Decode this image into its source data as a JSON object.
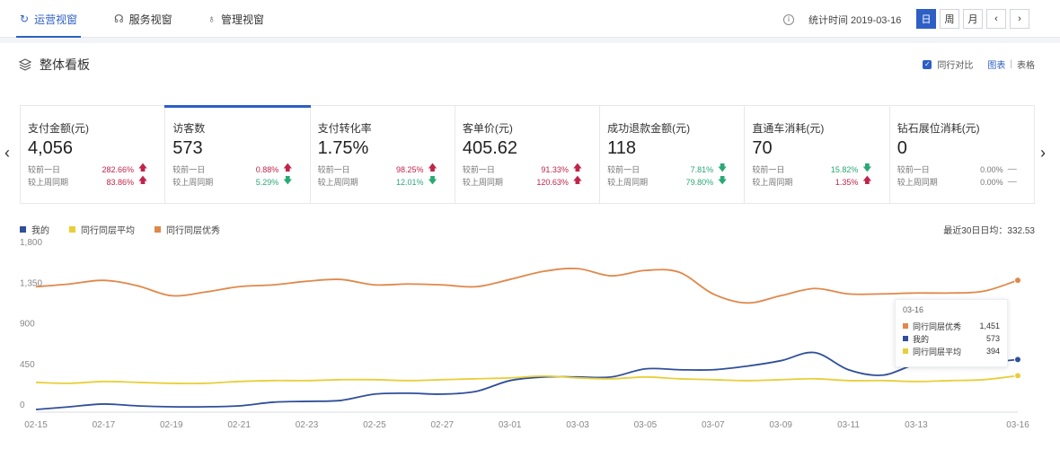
{
  "tabs": [
    {
      "label": "运营视窗",
      "icon": "refresh-icon"
    },
    {
      "label": "服务视窗",
      "icon": "headset-icon"
    },
    {
      "label": "管理视窗",
      "icon": "medal-icon"
    }
  ],
  "header": {
    "stat_label": "统计时间 2019-03-16",
    "periods": [
      "日",
      "周",
      "月"
    ],
    "prev": "‹",
    "next": "›"
  },
  "panel": {
    "title": "整体看板",
    "compare_label": "同行对比",
    "view_chart": "图表",
    "view_sep": "|",
    "view_table": "表格"
  },
  "metrics": [
    {
      "title": "支付金额(元)",
      "value": "4,056",
      "rows": [
        {
          "label": "较前一日",
          "pct": "282.66%",
          "dir": "up"
        },
        {
          "label": "较上周同期",
          "pct": "83.86%",
          "dir": "up"
        }
      ]
    },
    {
      "title": "访客数",
      "value": "573",
      "rows": [
        {
          "label": "较前一日",
          "pct": "0.88%",
          "dir": "up"
        },
        {
          "label": "较上周同期",
          "pct": "5.29%",
          "dir": "down"
        }
      ]
    },
    {
      "title": "支付转化率",
      "value": "1.75%",
      "rows": [
        {
          "label": "较前一日",
          "pct": "98.25%",
          "dir": "up"
        },
        {
          "label": "较上周同期",
          "pct": "12.01%",
          "dir": "down"
        }
      ]
    },
    {
      "title": "客单价(元)",
      "value": "405.62",
      "rows": [
        {
          "label": "较前一日",
          "pct": "91.33%",
          "dir": "up"
        },
        {
          "label": "较上周同期",
          "pct": "120.63%",
          "dir": "up"
        }
      ]
    },
    {
      "title": "成功退款金额(元)",
      "value": "118",
      "rows": [
        {
          "label": "较前一日",
          "pct": "7.81%",
          "dir": "down"
        },
        {
          "label": "较上周同期",
          "pct": "79.80%",
          "dir": "down"
        }
      ]
    },
    {
      "title": "直通车消耗(元)",
      "value": "70",
      "rows": [
        {
          "label": "较前一日",
          "pct": "15.82%",
          "dir": "down"
        },
        {
          "label": "较上周同期",
          "pct": "1.35%",
          "dir": "up"
        }
      ]
    },
    {
      "title": "钻石展位消耗(元)",
      "value": "0",
      "rows": [
        {
          "label": "较前一日",
          "pct": "0.00%",
          "dir": "flat"
        },
        {
          "label": "较上周同期",
          "pct": "0.00%",
          "dir": "flat"
        }
      ]
    }
  ],
  "colors": {
    "accent": "#2d5fc4",
    "up": "#c0244a",
    "down": "#2aa876",
    "mine": "#2f4f9a",
    "avg": "#e8cf3a",
    "best": "#e0884a"
  },
  "average_text": "最近30日日均：332.53",
  "chart_data": {
    "type": "line",
    "x": [
      "02-15",
      "02-16",
      "02-17",
      "02-18",
      "02-19",
      "02-20",
      "02-21",
      "02-22",
      "02-23",
      "02-24",
      "02-25",
      "02-26",
      "02-27",
      "02-28",
      "03-01",
      "03-02",
      "03-03",
      "03-04",
      "03-05",
      "03-06",
      "03-07",
      "03-08",
      "03-09",
      "03-10",
      "03-11",
      "03-12",
      "03-13",
      "03-14",
      "03-15",
      "03-16"
    ],
    "x_ticks": [
      "02-15",
      "02-17",
      "02-19",
      "02-21",
      "02-23",
      "02-25",
      "02-27",
      "03-01",
      "03-03",
      "03-05",
      "03-07",
      "03-09",
      "03-11",
      "03-13",
      "03-16"
    ],
    "ylim": [
      0,
      1800
    ],
    "y_ticks": [
      "0",
      "450",
      "900",
      "1,350",
      "1,800"
    ],
    "series": [
      {
        "name": "我的",
        "color": "#2f4f9a",
        "values": [
          20,
          50,
          80,
          60,
          50,
          50,
          60,
          100,
          110,
          120,
          190,
          200,
          190,
          220,
          340,
          380,
          380,
          380,
          470,
          460,
          460,
          500,
          560,
          650,
          460,
          400,
          520,
          560,
          540,
          573
        ]
      },
      {
        "name": "同行同层平均",
        "color": "#e8cf3a",
        "values": [
          320,
          310,
          330,
          320,
          310,
          310,
          330,
          340,
          340,
          350,
          350,
          340,
          350,
          360,
          370,
          390,
          370,
          360,
          380,
          360,
          350,
          340,
          350,
          360,
          340,
          340,
          330,
          340,
          350,
          394
        ]
      },
      {
        "name": "同行同层优秀",
        "color": "#e0884a",
        "values": [
          1380,
          1410,
          1450,
          1390,
          1280,
          1320,
          1380,
          1400,
          1440,
          1460,
          1400,
          1410,
          1400,
          1380,
          1460,
          1550,
          1580,
          1500,
          1560,
          1540,
          1300,
          1200,
          1280,
          1360,
          1300,
          1300,
          1310,
          1310,
          1330,
          1451
        ]
      }
    ],
    "grid": false,
    "legend": "top-left"
  },
  "tooltip": {
    "date": "03-16",
    "rows": [
      {
        "name": "同行同层优秀",
        "value": "1,451",
        "color": "#e0884a"
      },
      {
        "name": "我的",
        "value": "573",
        "color": "#2f4f9a"
      },
      {
        "name": "同行同层平均",
        "value": "394",
        "color": "#e8cf3a"
      }
    ]
  }
}
